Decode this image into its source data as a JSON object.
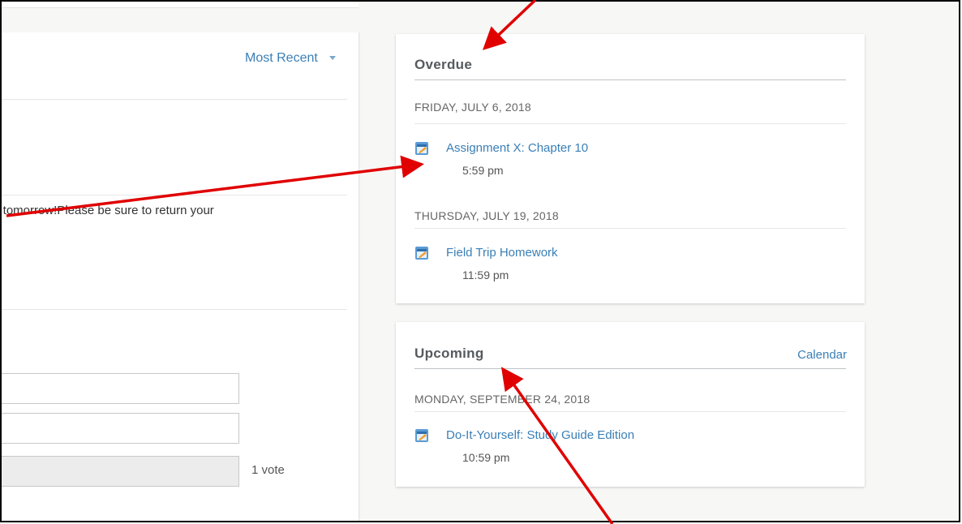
{
  "sort": {
    "label": "Most Recent"
  },
  "post": {
    "text": "y tomorrow!Please be sure to return your"
  },
  "poll": {
    "vote_label": "1 vote"
  },
  "overdue": {
    "title": "Overdue",
    "groups": [
      {
        "date": "FRIDAY, JULY 6, 2018",
        "items": [
          {
            "title": "Assignment X: Chapter 10",
            "time": "5:59 pm"
          }
        ]
      },
      {
        "date": "THURSDAY, JULY 19, 2018",
        "items": [
          {
            "title": "Field Trip Homework",
            "time": "11:59 pm"
          }
        ]
      }
    ]
  },
  "upcoming": {
    "title": "Upcoming",
    "calendar_label": "Calendar",
    "groups": [
      {
        "date": "MONDAY, SEPTEMBER 24, 2018",
        "items": [
          {
            "title": "Do-It-Yourself: Study Guide Edition",
            "time": "10:59 pm"
          }
        ]
      }
    ]
  },
  "icons": {
    "assignment": "assignment-icon",
    "arrow": "red-annotation-arrow"
  },
  "colors": {
    "link": "#3a7fb6",
    "arrow": "#e00000"
  }
}
